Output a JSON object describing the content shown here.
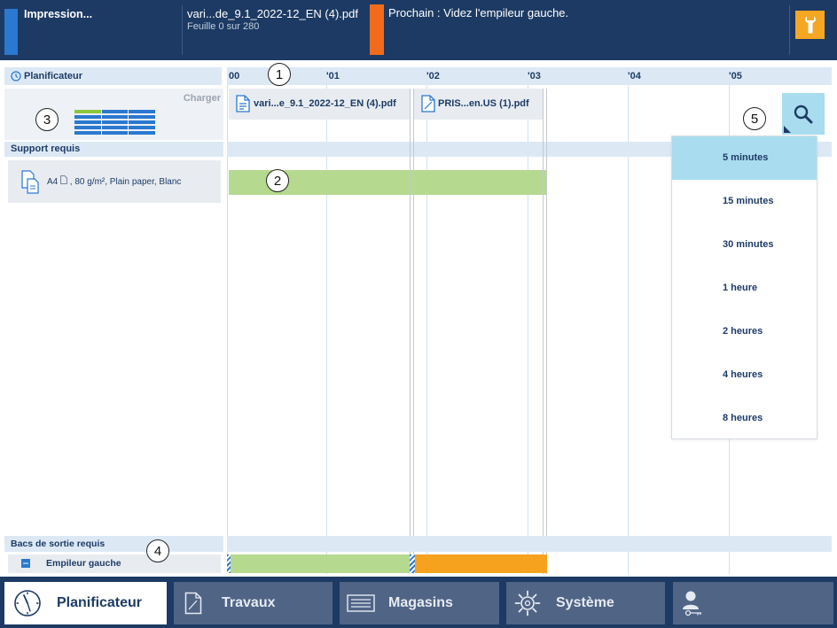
{
  "status_bar": {
    "printing_label": "Impression...",
    "current_job": "vari...de_9.1_2022-12_EN (4).pdf",
    "sheet_progress": "Feuille 0 sur 280",
    "next_message": "Prochain : Videz l'empileur gauche.",
    "maintenance_icon": "wrench-icon",
    "colors": {
      "printing": "#2b78d0",
      "next": "#f26b1d",
      "maintenance": "#f5a623"
    }
  },
  "planner": {
    "title": "Planificateur",
    "title_icon": "clock-icon",
    "timeline_labels": [
      "00",
      "'01",
      "'02",
      "'03",
      "'04",
      "'05"
    ],
    "load_label": "Charger",
    "jobs": [
      {
        "name": "vari...e_9.1_2022-12_EN (4).pdf",
        "icon": "document-icon"
      },
      {
        "name": "PRIS...en.US (1).pdf",
        "icon": "document-icon"
      }
    ],
    "media_section_title": "Support requis",
    "media": {
      "size": "A4",
      "details": ", 80 g/m², Plain paper, Blanc",
      "icon": "media-icon"
    },
    "output_section_title": "Bacs de sortie requis",
    "output_tray": {
      "name": "Empileur gauche",
      "icon": "stacker-icon"
    },
    "bar_colors": {
      "ready": "#b5d98f",
      "attention": "#f6a21e"
    }
  },
  "zoom": {
    "icon": "magnifier-icon",
    "options": [
      "5 minutes",
      "15 minutes",
      "30 minutes",
      "1 heure",
      "2 heures",
      "4 heures",
      "8 heures"
    ],
    "selected": "5 minutes"
  },
  "callouts": [
    "1",
    "2",
    "3",
    "4",
    "5"
  ],
  "nav": {
    "tabs": [
      {
        "label": "Planificateur",
        "icon": "clock-icon",
        "active": true
      },
      {
        "label": "Travaux",
        "icon": "document-icon",
        "active": false
      },
      {
        "label": "Magasins",
        "icon": "tray-icon",
        "active": false
      },
      {
        "label": "Système",
        "icon": "gear-icon",
        "active": false
      },
      {
        "icon": "user-key-icon",
        "active": false
      }
    ]
  }
}
